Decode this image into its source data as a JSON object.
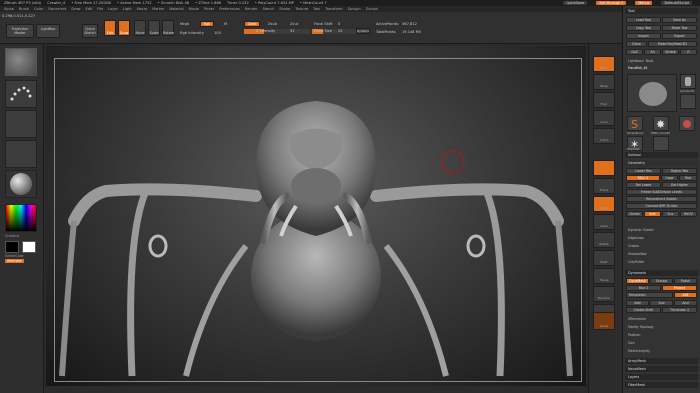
{
  "titlebar": {
    "title": "ZBrush 4R7 P3 (x64)",
    "doc": "Crawler_4",
    "stats": [
      "• Free Mem 27.263GB",
      "• Active Mem 1752",
      "• Scratch Disk 48",
      "• ZTime 1.886",
      "Timer 0.232",
      "• PolyCount 7.632 MP",
      "• MeshCount 7"
    ],
    "right_buttons": [
      "QuickSave",
      "See-through 0",
      "Menus",
      "DefaultZScript"
    ]
  },
  "menubar": [
    "Alpha",
    "Brush",
    "Color",
    "Document",
    "Draw",
    "Edit",
    "File",
    "Layer",
    "Light",
    "Macro",
    "Marker",
    "Material",
    "Movie",
    "Picker",
    "Preferences",
    "Render",
    "Stencil",
    "Stroke",
    "Texture",
    "Tool",
    "Transform",
    "Zplugin",
    "Zscript"
  ],
  "shelf": {
    "projection_master": "Projection Master",
    "lightbox": "LightBox",
    "quick_sketch": "Quick Sketch",
    "edit": "Edit",
    "draw": "Draw",
    "move": "Move",
    "scale": "Scale",
    "rotate": "Rotate",
    "mrgb": "Mrgb",
    "rgb": "Rgb",
    "m": "M",
    "zadd": "Zadd",
    "zsub": "Zsub",
    "zcut": "Zcut",
    "rgb_intensity_label": "Rgb Intensity",
    "rgb_intensity": "100",
    "z_intensity_label": "Z Intensity",
    "z_intensity": "31",
    "focal_shift_label": "Focal Shift",
    "focal_shift": "0",
    "draw_size_label": "Draw Size",
    "draw_size": "22",
    "dynamic": "Dynamic",
    "active_points_label": "ActivePoints:",
    "active_points": "567,812",
    "total_points_label": "TotalPoints:",
    "total_points": "19.148 Mil",
    "coords": "0.298,0.011,0.227"
  },
  "leftshelf": {
    "labels": [
      "Gradient",
      "SwitchColor",
      "Alternate"
    ]
  },
  "rightshelf": [
    "SPix 3",
    "Persp",
    "Floor",
    "Local",
    "L.Sym",
    "Frame",
    "Move",
    "Scale",
    "Rotate",
    "PolyF",
    "Transp",
    "Dynamic",
    "Solo",
    "Xpose"
  ],
  "panel": {
    "title": "Tool",
    "rows": [
      [
        "Load Tool",
        "Save As"
      ],
      [
        "Copy Tool",
        "Paste Tool"
      ],
      [
        "Import",
        "Export"
      ],
      [
        "Clone",
        "Make PolyMesh3D"
      ],
      [
        "GoZ",
        "All",
        "Visible",
        "R"
      ]
    ],
    "lightbox_tools": "Lightbox> Tools",
    "current_tool": "HandBot_48",
    "tools": [
      "Cylinder3D",
      "SimpleBrush",
      "PM3D_Cube3D",
      "Polymesh",
      "ZSphere",
      "HandBot"
    ],
    "sections": [
      "Subtool",
      "Geometry",
      "Dynamesh",
      "ArrayMesh",
      "NanoMesh",
      "Layers",
      "FiberMesh"
    ],
    "geometry": {
      "lower_res": "Lower Res",
      "higher_res": "Higher Res",
      "sdiv": "SDiv 3",
      "cage": "Cage",
      "rstr": "Rstr",
      "del_lower": "Del Lower",
      "del_higher": "Del Higher",
      "freeze": "Freeze SubDivision Levels",
      "reconstruct": "Reconstruct Subdiv",
      "convert_bpr": "Convert BPR To Geo",
      "divide": "Divide",
      "smt": "Smt",
      "suv": "Suv",
      "reuv": "ReUV",
      "dynamic_subdiv": "Dynamic Subdiv",
      "edgeloop": "EdgeLoop",
      "crease": "Crease",
      "shadowbox": "ShadowBox",
      "claypolish": "ClayPolish"
    },
    "dynamesh": {
      "dynamesh_btn": "DynaMesh",
      "groups": "Groups",
      "polish": "Polish",
      "blur": "Blur 2",
      "project": "Project",
      "resolution_label": "Resolution",
      "resolution": "448",
      "add": "Add",
      "sub": "Sub",
      "and": "And",
      "create_shell": "Create Shell",
      "thickness": "Thickness 4"
    },
    "other": [
      "ZRemesher",
      "Modify Topology",
      "Position",
      "Size",
      "MeshIntegrity"
    ]
  },
  "colors": {
    "accent": "#e0701d",
    "panel": "#333333",
    "background": "#2b2b2b"
  }
}
